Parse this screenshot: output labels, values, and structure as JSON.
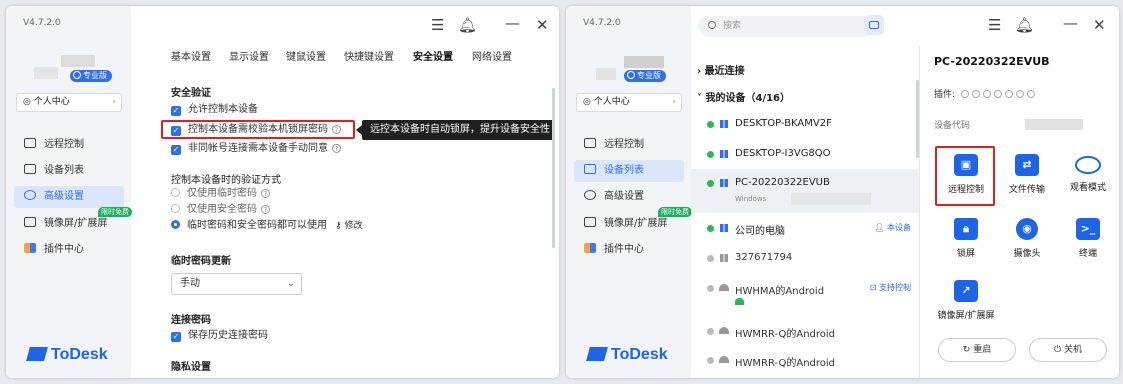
{
  "window1": {
    "version": "V4.7.2.0",
    "pro_badge": "专业版",
    "personal_center": "个人中心",
    "nav": [
      {
        "label": "远程控制"
      },
      {
        "label": "设备列表"
      },
      {
        "label": "高级设置"
      },
      {
        "label": "镜像屏/扩展屏",
        "badge": "限时免费"
      },
      {
        "label": "插件中心"
      }
    ],
    "logo": "ToDesk",
    "tabs": [
      "基本设置",
      "显示设置",
      "键鼠设置",
      "快捷键设置",
      "安全设置",
      "网络设置"
    ],
    "active_tab": "安全设置",
    "security": {
      "title": "安全验证",
      "options": [
        {
          "label": "允许控制本设备",
          "checked": true
        },
        {
          "label": "控制本设备需校验本机锁屏密码",
          "checked": true,
          "help": "?"
        },
        {
          "label": "非同帐号连接需本设备手动同意",
          "checked": true,
          "help": "?"
        }
      ],
      "tooltip": "远控本设备时自动锁屏，提升设备安全性"
    },
    "verify": {
      "title": "控制本设备时的验证方式",
      "options": [
        {
          "label": "仅使用临时密码",
          "selected": false
        },
        {
          "label": "仅使用安全密码",
          "selected": false
        },
        {
          "label": "临时密码和安全密码都可以使用",
          "selected": true
        }
      ],
      "edit": "修改"
    },
    "temp_pwd": {
      "title": "临时密码更新",
      "value": "手动"
    },
    "conn_pwd": {
      "title": "连接密码",
      "option": "保存历史连接密码"
    },
    "privacy": {
      "title": "隐私设置"
    }
  },
  "window2": {
    "version": "V4.7.2.0",
    "pro_badge": "专业版",
    "personal_center": "个人中心",
    "nav": [
      {
        "label": "远程控制"
      },
      {
        "label": "设备列表"
      },
      {
        "label": "高级设置"
      },
      {
        "label": "镜像屏/扩展屏",
        "badge": "限时免费"
      },
      {
        "label": "插件中心"
      }
    ],
    "logo": "ToDesk",
    "search_placeholder": "搜索",
    "groups": {
      "recent": "最近连接",
      "mine": "我的设备（4/16）"
    },
    "devices": [
      {
        "name": "DESKTOP-BKAMV2F",
        "online": true
      },
      {
        "name": "DESKTOP-I3VG8QO",
        "online": true
      },
      {
        "name": "PC-20220322EVUB",
        "online": true,
        "sub": "Windows"
      },
      {
        "name": "公司的电脑",
        "online": true,
        "tag": "本设备"
      },
      {
        "name": "327671794",
        "online": false
      },
      {
        "name": "HWHMA的Android",
        "online": false,
        "tag": "支持控制"
      },
      {
        "name": "HWMRR-Q的Android",
        "online": false
      },
      {
        "name": "HWMRR-Q的Android",
        "online": false
      }
    ],
    "panel": {
      "device_name": "PC-20220322EVUB",
      "plugins_label": "插件:",
      "device_code_label": "设备代码",
      "actions": [
        "远程控制",
        "文件传输",
        "观看模式",
        "锁屏",
        "摄像头",
        "终端",
        "镜像屏/扩展屏"
      ],
      "restart": "重启",
      "shutdown": "关机"
    }
  },
  "colors": {
    "accent": "#2f6fec",
    "highlight": "#e02020",
    "online": "#2db55d"
  }
}
